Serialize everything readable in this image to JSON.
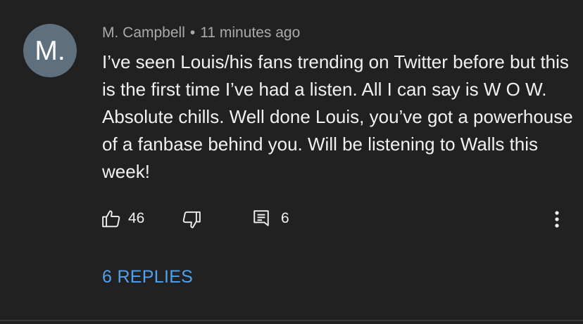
{
  "comment": {
    "avatar_initial": "M.",
    "author": "M. Campbell",
    "separator": "•",
    "time_ago": "11 minutes ago",
    "text": "I’ve seen Louis/his fans trending on Twitter before but this is the first time I’ve had a listen. All I can say is W O W. Absolute chills. Well done Louis, you’ve got a powerhouse of a fanbase behind you. Will be listening to Walls this week!",
    "like_count": "46",
    "reply_count": "6",
    "replies_label": "6 REPLIES"
  },
  "icons": {
    "like": "thumbs-up-icon",
    "dislike": "thumbs-down-icon",
    "reply": "comment-icon",
    "more": "more-vertical-icon"
  },
  "colors": {
    "background": "#212121",
    "avatar": "#5e6f7e",
    "link": "#4fa0ef",
    "secondary_text": "#aaaaaa",
    "primary_text": "#f1f1f1"
  }
}
